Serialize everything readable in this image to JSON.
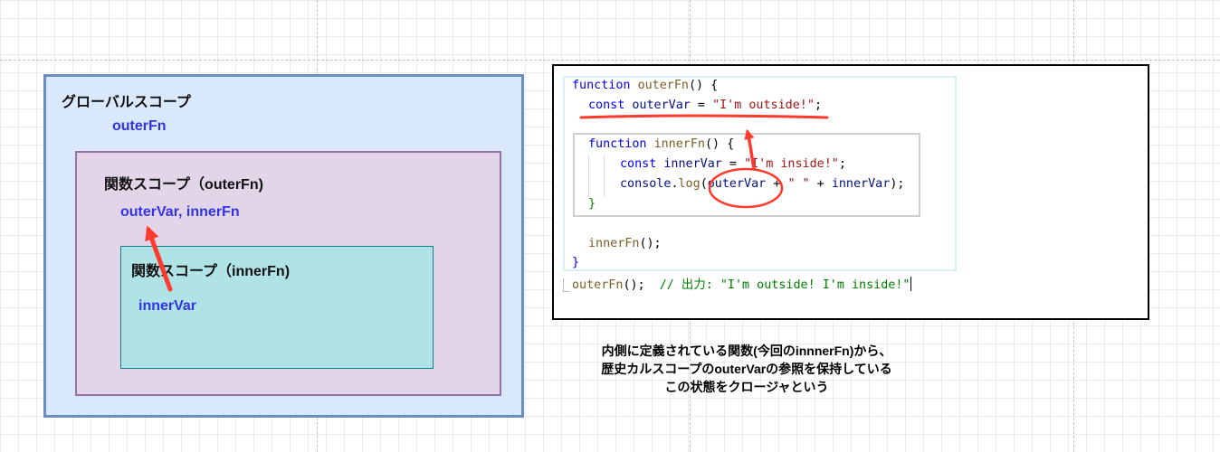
{
  "diagram": {
    "global_scope": {
      "title": "グローバルスコープ",
      "vars": "outerFn"
    },
    "outer_scope": {
      "title": "関数スコープ（outerFn)",
      "vars": "outerVar,  innerFn"
    },
    "inner_scope": {
      "title": "関数スコープ（innerFn)",
      "vars": "innerVar"
    }
  },
  "code": {
    "lines": [
      {
        "k": "function",
        "f": "outerFn",
        "p": "() {"
      },
      {
        "k": "const",
        "i": "outerVar",
        "p": " = ",
        "s": "\"I'm outside!\"",
        "e": ";"
      },
      {
        "k": "function",
        "f": "innerFn",
        "p": "() {"
      },
      {
        "k": "const",
        "i": "innerVar",
        "p": " = ",
        "s": "\"I'm inside!\"",
        "e": ";"
      },
      {
        "i1": "console",
        "p1": ".",
        "f": "log",
        "p2": "(",
        "i2": "outerVar",
        "p3": " + ",
        "s": "\" \"",
        "p4": " + ",
        "i3": "innerVar",
        "e": ");"
      },
      {
        "p": "}"
      },
      {
        "f": "innerFn",
        "p": "();"
      },
      {
        "p": "}"
      },
      {
        "f": "outerFn",
        "p": "();",
        "c": "// 出力: \"I'm outside! I'm inside!\""
      }
    ]
  },
  "explanation": [
    "内側に定義されている関数(今回のinnnerFn)から、",
    "歴史カルスコープのouterVarの参照を保持している",
    "この状態をクロージャという"
  ],
  "colors": {
    "annotation": "#ff3a2e",
    "global_fill": "#dae8fc",
    "outer_fill": "#e1d5e7",
    "inner_fill": "#b0e3e6"
  }
}
